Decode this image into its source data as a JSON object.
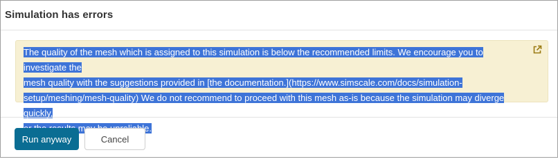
{
  "dialog": {
    "title": "Simulation has errors",
    "message": {
      "lines": [
        "The quality of the mesh which is assigned to this simulation is below the recommended limits. We encourage you to investigate the",
        "mesh quality with the suggestions provided in [the documentation.](https://www.simscale.com/docs/simulation-",
        "setup/meshing/mesh-quality) We do not recommend to proceed with this mesh as-is because the simulation may diverge quickly,",
        "or the results may be unreliable."
      ],
      "icon": "external-link-icon"
    },
    "buttons": {
      "run_anyway": "Run anyway",
      "cancel": "Cancel"
    }
  },
  "colors": {
    "warning_background": "#f7f0d3",
    "selection_highlight": "#3e74d8",
    "primary_button": "#0a6d93"
  }
}
